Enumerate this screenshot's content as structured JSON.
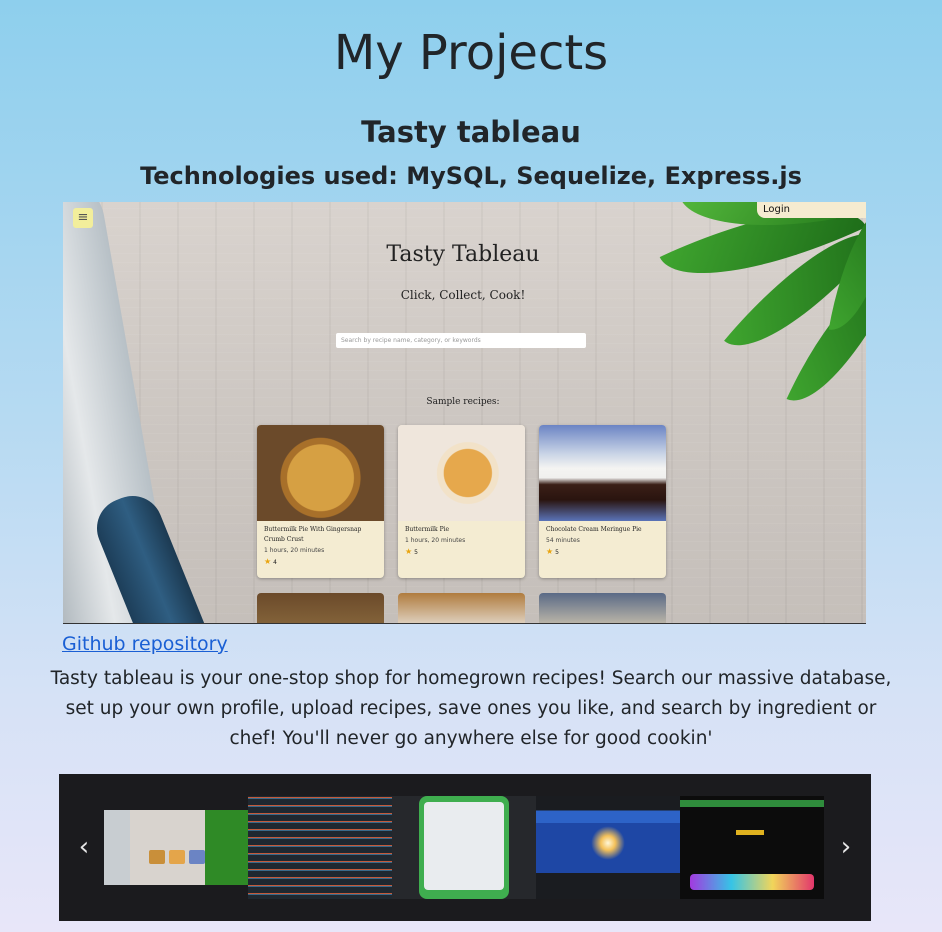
{
  "page": {
    "title": "My Projects"
  },
  "project": {
    "name": "Tasty tableau",
    "technologies": "Technologies used: MySQL, Sequelize, Express.js",
    "github_link_label": "Github repository",
    "description": "Tasty tableau is your one-stop shop for homegrown recipes! Search our massive database, set up your own profile, upload recipes, save ones you like, and search by ingredient or chef! You'll never go anywhere else for good cookin'"
  },
  "screenshot": {
    "login_label": "Login",
    "app_title": "Tasty Tableau",
    "app_subtitle": "Click, Collect, Cook!",
    "search_placeholder": "Search by recipe name, category, or keywords",
    "sample_label": "Sample recipes:",
    "recipes": [
      {
        "name": "Buttermilk Pie With Gingersnap Crumb Crust",
        "time": "1 hours, 20 minutes",
        "rating": "4"
      },
      {
        "name": "Buttermilk Pie",
        "time": "1 hours, 20 minutes",
        "rating": "5"
      },
      {
        "name": "Chocolate Cream Meringue Pie",
        "time": "54 minutes",
        "rating": "5"
      }
    ]
  },
  "carousel": {
    "prev_icon": "chevron-left-icon",
    "next_icon": "chevron-right-icon",
    "prev_glyph": "‹",
    "next_glyph": "›",
    "thumbnails": [
      "tasty-tableau",
      "code-screen",
      "search-modal",
      "space-page",
      "tech-blog"
    ]
  },
  "colors": {
    "link": "#1a5fd4",
    "carousel_bg": "#1b1b1e",
    "card_bg": "#f4ecd2"
  }
}
